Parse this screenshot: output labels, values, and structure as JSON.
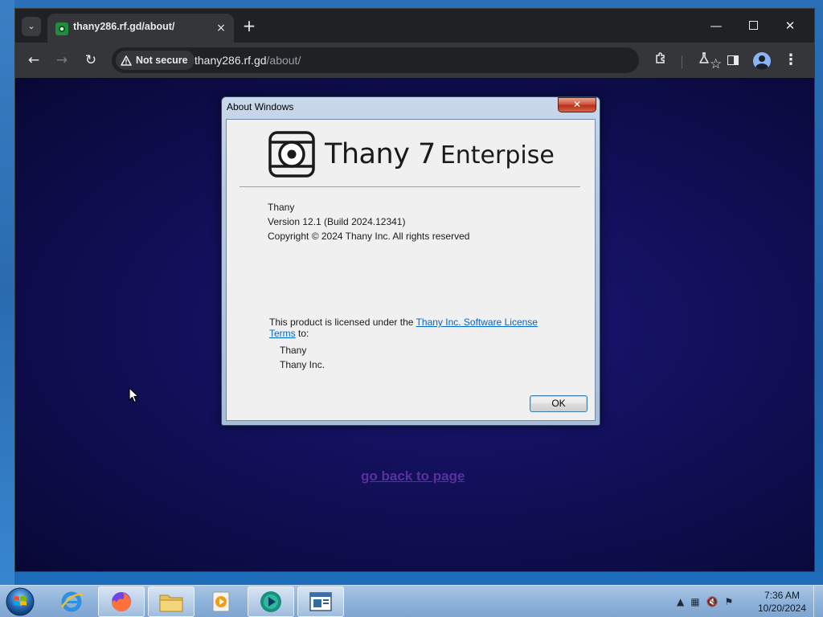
{
  "browser": {
    "tab_title": "thany286.rf.gd/about/",
    "tab_close": "×",
    "new_tab": "+",
    "security_label": "Not secure",
    "url_host": "thany286.rf.gd",
    "url_path": "/about/"
  },
  "page": {
    "go_back_link": "go back to page"
  },
  "dialog": {
    "title": "About Windows",
    "close_label": "✕",
    "product_name": "Thany 7",
    "product_edition": "Enterpise",
    "info_lines": [
      "Thany",
      "Version 12.1 (Build 2024.12341)",
      "Copyright © 2024 Thany Inc. All rights reserved"
    ],
    "license_prefix": "This product is licensed under the ",
    "license_link": "Thany Inc. Software License Terms",
    "license_suffix": " to:",
    "licensees": [
      "Thany",
      "Thany Inc."
    ],
    "ok_label": "OK"
  },
  "taskbar": {
    "clock_time": "7:36 AM",
    "clock_date": "10/20/2024",
    "apps": [
      {
        "name": "internet-explorer",
        "active": false
      },
      {
        "name": "firefox",
        "active": true
      },
      {
        "name": "file-explorer",
        "active": true
      },
      {
        "name": "media-player",
        "active": false
      },
      {
        "name": "chrome",
        "active": true
      },
      {
        "name": "window",
        "active": true
      }
    ]
  }
}
